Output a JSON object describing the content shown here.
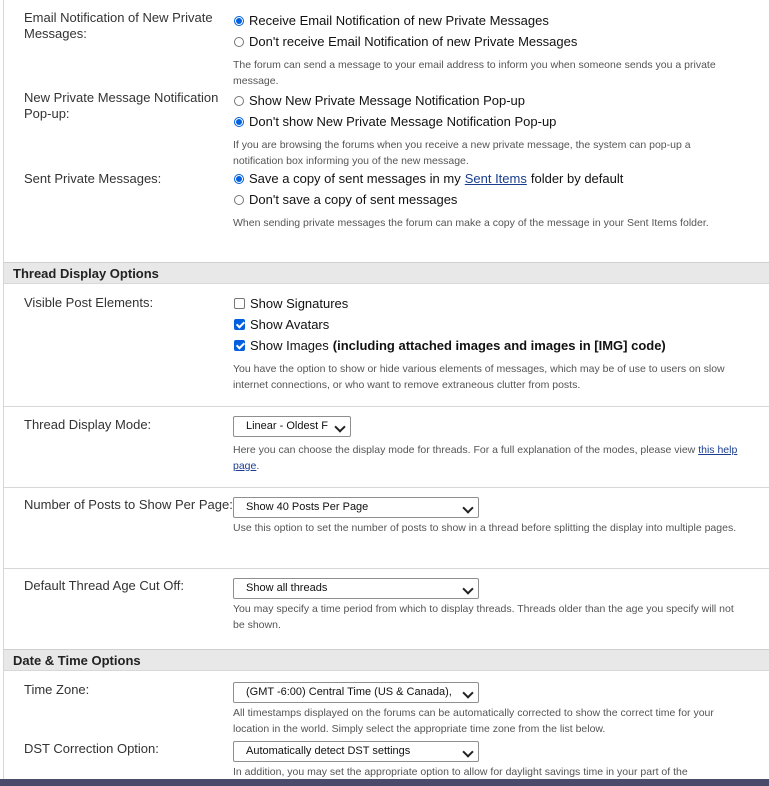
{
  "pm": {
    "email": {
      "label": "Email Notification of New Private Messages:",
      "opt1": "Receive Email Notification of new Private Messages",
      "opt2": "Don't receive Email Notification of new Private Messages",
      "selected": 1,
      "desc": "The forum can send a message to your email address to inform you when someone sends you a private message."
    },
    "popup": {
      "label": "New Private Message Notification Pop-up:",
      "opt1": "Show New Private Message Notification Pop-up",
      "opt2": "Don't show New Private Message Notification Pop-up",
      "selected": 2,
      "desc": "If you are browsing the forums when you receive a new private message, the system can pop-up a notification box informing you of the new message."
    },
    "sent": {
      "label": "Sent Private Messages:",
      "opt1_pre": "Save a copy of sent messages in my",
      "opt1_link": "Sent Items",
      "opt1_post": "folder by default",
      "opt2": "Don't save a copy of sent messages",
      "selected": 1,
      "desc": "When sending private messages the forum can make a copy of the message in your Sent Items folder."
    }
  },
  "thread": {
    "header": "Thread Display Options",
    "visible": {
      "label": "Visible Post Elements:",
      "signatures": "Show Signatures",
      "avatars": "Show Avatars",
      "images": "Show Images",
      "images_note": "(including attached images and images in [IMG] code)",
      "checked": {
        "signatures": false,
        "avatars": true,
        "images": true
      },
      "desc": "You have the option to show or hide various elements of messages, which may be of use to users on slow internet connections, or who want to remove extraneous clutter from posts."
    },
    "mode": {
      "label": "Thread Display Mode:",
      "value": "Linear - Oldest F",
      "desc_pre": "Here you can choose the display mode for threads. For a full explanation of the modes, please view",
      "desc_link": "this help page",
      "desc_post": "."
    },
    "posts": {
      "label": "Number of Posts to Show Per Page:",
      "value": "Show 40 Posts Per Page",
      "desc": "Use this option to set the number of posts to show in a thread before splitting the display into multiple pages."
    },
    "age": {
      "label": "Default Thread Age Cut Off:",
      "value": "Show all threads",
      "desc": "You may specify a time period from which to display threads. Threads older than the age you specify will not be shown."
    }
  },
  "datetime": {
    "header": "Date & Time Options",
    "tz": {
      "label": "Time Zone:",
      "value": "(GMT -6:00) Central Time (US & Canada),",
      "desc": "All timestamps displayed on the forums can be automatically corrected to show the correct time for your location in the world. Simply select the appropriate time zone from the list below."
    },
    "dst": {
      "label": "DST Correction Option:",
      "value": "Automatically detect DST settings",
      "desc": "In addition, you may set the appropriate option to allow for daylight savings time in your part of the"
    }
  }
}
